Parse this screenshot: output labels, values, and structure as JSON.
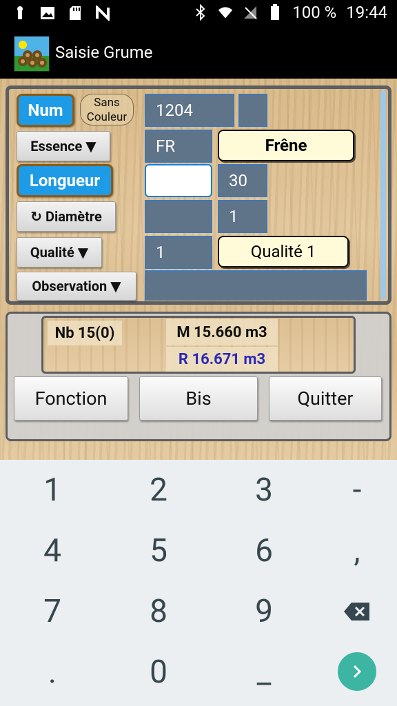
{
  "status": {
    "battery": "100 %",
    "time": "19:44"
  },
  "app": {
    "title": "Saisie Grume"
  },
  "form": {
    "num_label": "Num",
    "sans_couleur": "Sans\nCouleur",
    "num_value": "1204",
    "num_extra": "",
    "essence_label": "Essence ▼",
    "essence_code": "FR",
    "essence_name": "Frêne",
    "longueur_label": "Longueur",
    "longueur_input": "",
    "longueur_value": "30",
    "diametre_label": "↻ Diamètre",
    "diametre_input": "",
    "diametre_value": "1",
    "qualite_label": "Qualité ▼",
    "qualite_code": "1",
    "qualite_name": "Qualité 1",
    "observation_label": "Observation ▼",
    "observation_value": ""
  },
  "summary": {
    "nb": "Nb 15(0)",
    "m": "M 15.660 m3",
    "r": "R  16.671 m3"
  },
  "actions": {
    "fonction": "Fonction",
    "bis": "Bis",
    "quitter": "Quitter"
  },
  "keyboard": {
    "k1": "1",
    "k2": "2",
    "k3": "3",
    "kminus": "-",
    "k4": "4",
    "k5": "5",
    "k6": "6",
    "kcomma": ",",
    "k7": "7",
    "k8": "8",
    "k9": "9",
    "kdot": ".",
    "k0": "0",
    "kspace": "_"
  }
}
